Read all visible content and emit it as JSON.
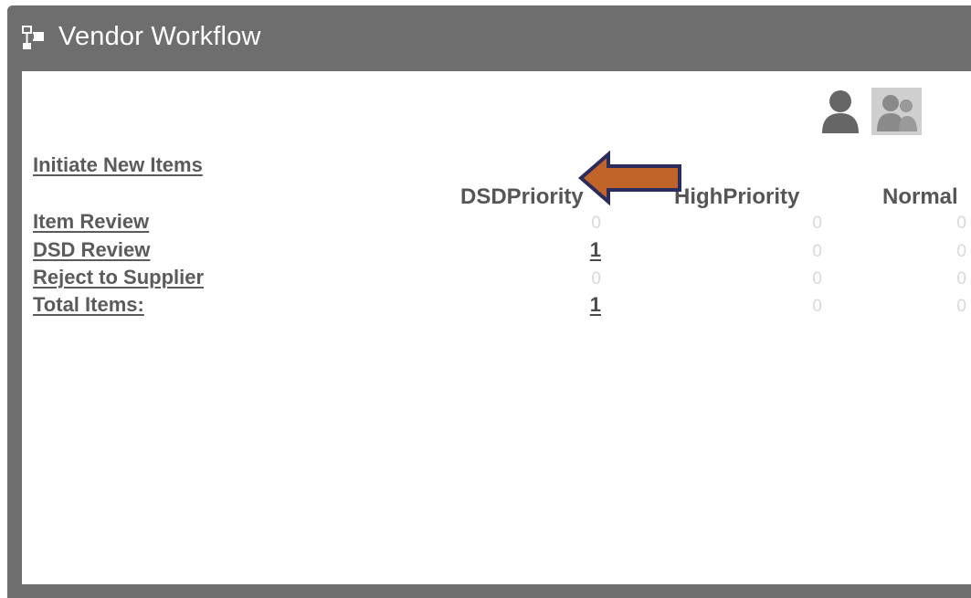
{
  "window": {
    "title": "Vendor Workflow"
  },
  "links": {
    "initiate": "Initiate New Items"
  },
  "table": {
    "columns": [
      "DSDPriority",
      "HighPriority",
      "Normal"
    ],
    "rows": [
      {
        "label": "Item Review",
        "values": [
          "0",
          "0",
          "0"
        ]
      },
      {
        "label": "DSD Review",
        "values": [
          "1",
          "0",
          "0"
        ]
      },
      {
        "label": "Reject to Supplier",
        "values": [
          "0",
          "0",
          "0"
        ]
      },
      {
        "label": "Total Items:",
        "values": [
          "1",
          "0",
          "0"
        ]
      }
    ]
  },
  "icons": {
    "title": "workflow-icon",
    "user": "user-icon",
    "group": "group-icon",
    "annotation": "arrow-left-icon"
  },
  "colors": {
    "titlebar": "#6e6e6e",
    "arrow_fill": "#c0642a",
    "arrow_stroke": "#2b2b5c"
  }
}
